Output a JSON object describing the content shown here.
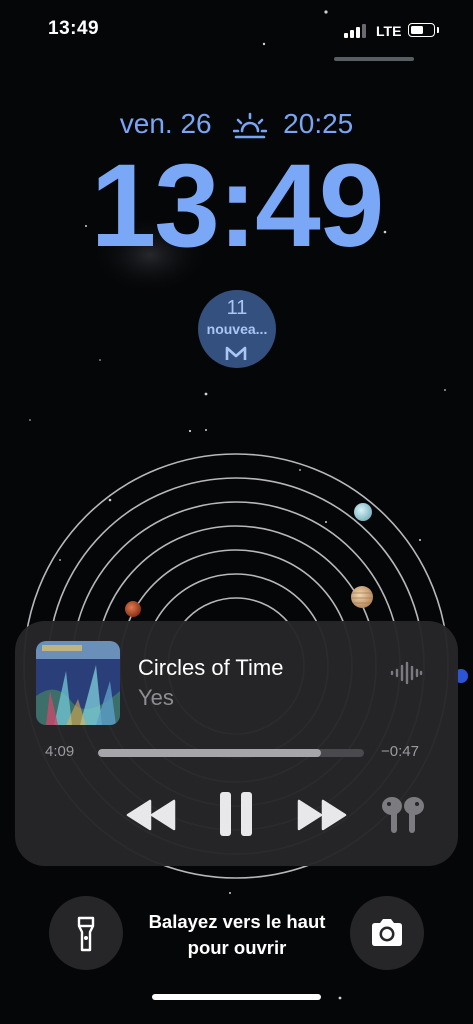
{
  "status_bar": {
    "time": "13:49",
    "network": "LTE",
    "battery_level": 0.55,
    "signal_bars": 3
  },
  "lock_screen": {
    "date": "ven. 26",
    "sunset_time": "20:25",
    "clock": "13:49",
    "widget": {
      "count": "11",
      "label": "nouvea...",
      "icon": "mail-icon"
    },
    "swipe_hint": [
      "Balayez vers le haut",
      "pour ouvrir"
    ]
  },
  "now_playing": {
    "title": "Circles of Time",
    "artist": "Yes",
    "elapsed": "4:09",
    "remaining": "−0:47",
    "progress": 0.84,
    "controls": [
      "rewind-icon",
      "pause-icon",
      "fast-forward-icon",
      "airpods-icon"
    ]
  },
  "colors": {
    "accent": "#7aa8f6",
    "widget_bg": "#34507e",
    "player_bg": "#262628"
  }
}
